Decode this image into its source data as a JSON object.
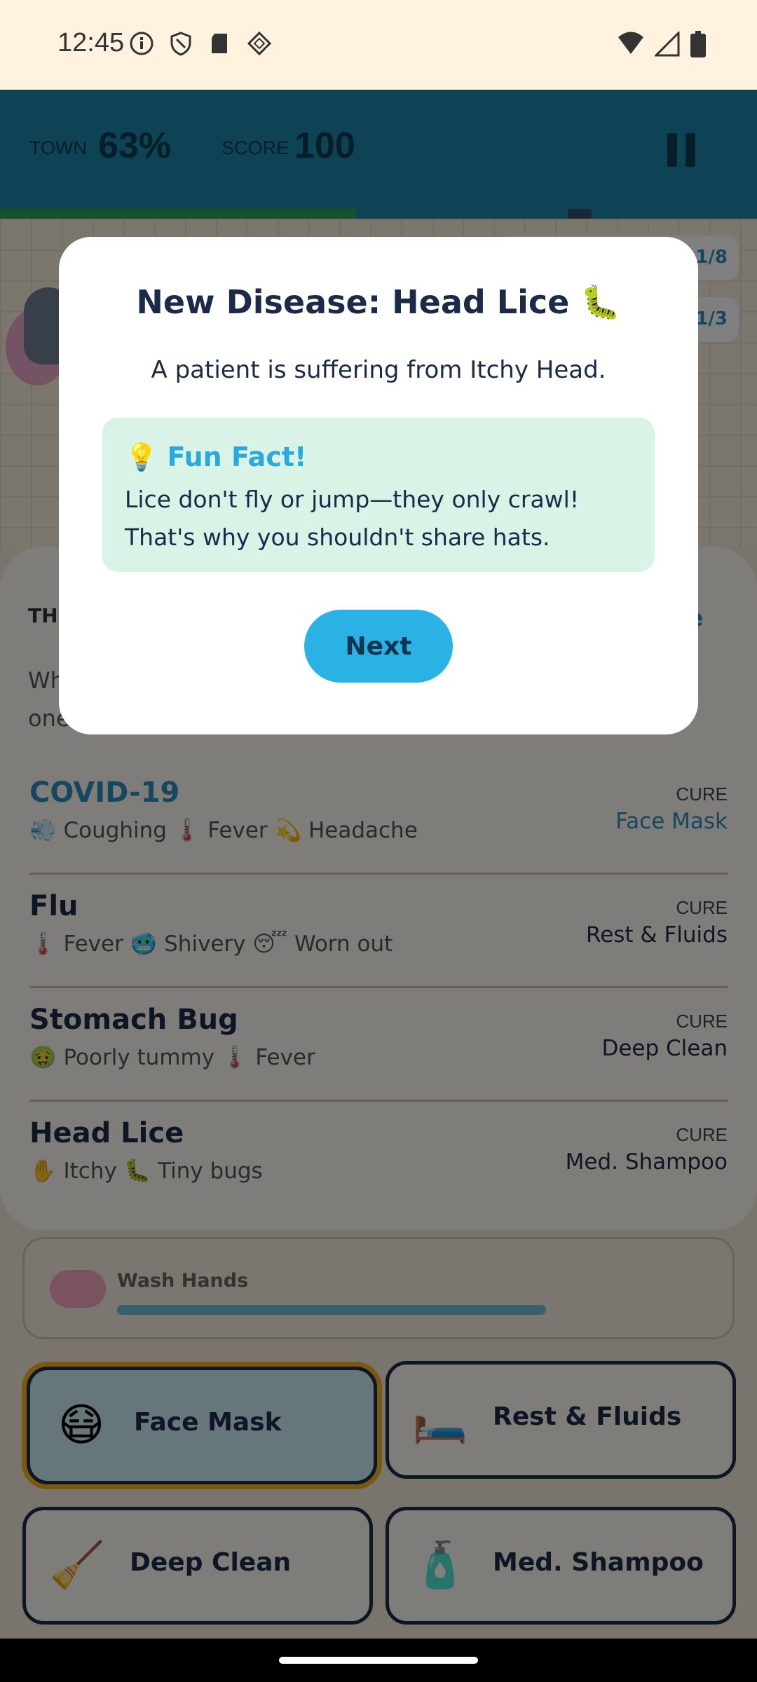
{
  "status_bar": {
    "time": "12:45",
    "left_icons": [
      "info-icon",
      "shield-icon",
      "sd-card-icon",
      "diamond-grid-icon"
    ],
    "right_icons": [
      "wifi-icon",
      "signal-icon",
      "battery-icon"
    ]
  },
  "header": {
    "town_label": "TOWN",
    "town_value": "63%",
    "score_label": "SCORE",
    "score_value": "100",
    "town_progress_percent": 47,
    "pause_icon": "pause-icon",
    "colors": {
      "background": "#1d84aa",
      "progress_fill": "#2ea15b"
    }
  },
  "missions": [
    {
      "count": "1/8"
    },
    {
      "count": "1/3"
    }
  ],
  "panel": {
    "title_fragment": "TH",
    "link_fragment": "se",
    "subtitle_fragments": [
      "Wh",
      "one"
    ],
    "diseases": [
      {
        "name": "COVID-19",
        "symptoms": "💨 Coughing  🌡️ Fever  💫 Headache",
        "cure_label": "CURE",
        "cure": "Face Mask",
        "active": true
      },
      {
        "name": "Flu",
        "symptoms": "🌡️ Fever  🥶 Shivery  😴 Worn out",
        "cure_label": "CURE",
        "cure": "Rest & Fluids",
        "active": false
      },
      {
        "name": "Stomach Bug",
        "symptoms": "🤢 Poorly tummy  🌡️ Fever",
        "cure_label": "CURE",
        "cure": "Deep Clean",
        "active": false
      },
      {
        "name": "Head Lice",
        "symptoms": "✋ Itchy  🐛 Tiny bugs",
        "cure_label": "CURE",
        "cure": "Med. Shampoo",
        "active": false
      }
    ]
  },
  "wash_hands": {
    "label": "Wash Hands",
    "icon": "soap-icon"
  },
  "cures": [
    {
      "label": "Face Mask",
      "icon": "😷",
      "selected": true
    },
    {
      "label": "Rest & Fluids",
      "icon": "🛏️",
      "selected": false
    },
    {
      "label": "Deep Clean",
      "icon": "🧹",
      "selected": false
    },
    {
      "label": "Med. Shampoo",
      "icon": "🧴",
      "selected": false
    }
  ],
  "modal": {
    "title": "New Disease: Head Lice 🐛",
    "body": "A patient is suffering from Itchy Head.",
    "fact_heading": "💡 Fun Fact!",
    "fact_text": "Lice don't fly or jump—they only crawl! That's why you shouldn't share hats.",
    "next_label": "Next",
    "colors": {
      "accent": "#2ab2e5",
      "fact_bg": "#d9f3e7"
    }
  }
}
